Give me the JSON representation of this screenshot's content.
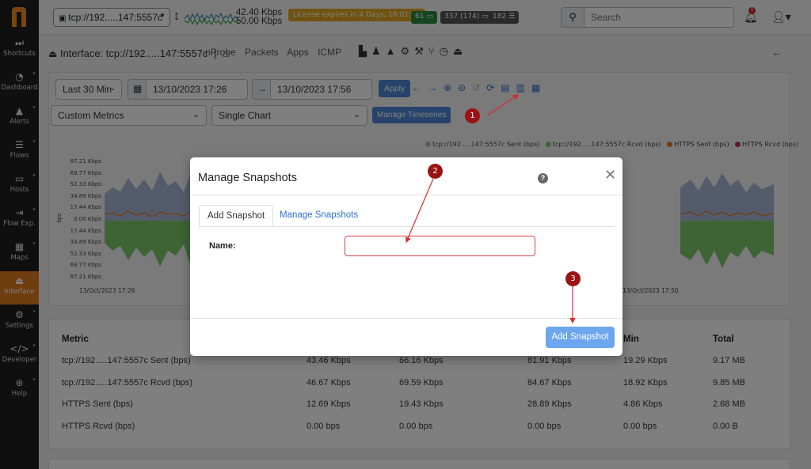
{
  "sidebar": {
    "items": [
      {
        "label": "Shortcuts",
        "icon": "fast-forward-icon"
      },
      {
        "label": "Dashboard",
        "icon": "gauge-icon"
      },
      {
        "label": "Alerts",
        "icon": "warning-icon"
      },
      {
        "label": "Flows",
        "icon": "list-icon"
      },
      {
        "label": "Hosts",
        "icon": "laptop-icon"
      },
      {
        "label": "Flow Exp.",
        "icon": "export-icon"
      },
      {
        "label": "Maps",
        "icon": "map-icon"
      },
      {
        "label": "Interface",
        "icon": "interface-icon",
        "active": true
      },
      {
        "label": "Settings",
        "icon": "gear-icon"
      },
      {
        "label": "Developer",
        "icon": "code-icon"
      },
      {
        "label": "Help",
        "icon": "life-ring-icon"
      }
    ]
  },
  "topbar": {
    "interface_label": "tcp://192.....147:5557c",
    "rate_up": "42.40 Kbps",
    "rate_down": "50.00 Kbps",
    "license": "License expires in 4 Days, 16:01:47",
    "badge_alerts": "61",
    "badge_hosts": "337 (174)",
    "badge_flows": "182",
    "search_placeholder": "Search",
    "notification_count": "1"
  },
  "page_header": {
    "title": "Interface: tcp://192.....147:5557c",
    "separator": "|",
    "links": [
      "nProbe",
      "Packets",
      "Apps",
      "ICMP"
    ]
  },
  "controls": {
    "range": "Last 30 Min",
    "date_from": "13/10/2023 17:26",
    "date_to": "13/10/2023 17:56",
    "apply": "Apply",
    "metrics": "Custom Metrics",
    "chart_mode": "Single Chart",
    "manage_timeseries": "Manage Timeseries"
  },
  "chart": {
    "legend": [
      {
        "name": "tcp://192.....147:5557c Sent (bps)",
        "color": "#a9b9d9"
      },
      {
        "name": "tcp://192.....147:5557c Rcvd (bps)",
        "color": "#7cc96a"
      },
      {
        "name": "HTTPS Sent (bps)",
        "color": "#e07a1f"
      },
      {
        "name": "HTTPS Rcvd (bps)",
        "color": "#b83a3a"
      }
    ],
    "yticks": [
      "87.21 Kbps",
      "69.77 Kbps",
      "52.33 Kbps",
      "34.89 Kbps",
      "17.44 Kbps",
      "0.00 Kbps",
      "17.44 Kbps",
      "34.89 Kbps",
      "52.33 Kbps",
      "69.77 Kbps",
      "87.21 Kbps"
    ],
    "ylabel": "bps",
    "xticks": [
      "13/Oct/2023 17:26",
      "13/Oct/2023 17:50"
    ]
  },
  "table": {
    "headers": [
      "Metric",
      "",
      "",
      "",
      "Min",
      "Total"
    ],
    "rows": [
      [
        "tcp://192.....147:5557c Sent (bps)",
        "43.46 Kbps",
        "66.16 Kbps",
        "81.91 Kbps",
        "19.29 Kbps",
        "9.17 MB"
      ],
      [
        "tcp://192.....147:5557c Rcvd (bps)",
        "46.67 Kbps",
        "69.59 Kbps",
        "84.67 Kbps",
        "18.92 Kbps",
        "9.85 MB"
      ],
      [
        "HTTPS Sent (bps)",
        "12.69 Kbps",
        "19.43 Kbps",
        "28.89 Kbps",
        "4.86 Kbps",
        "2.68 MB"
      ],
      [
        "HTTPS Rcvd (bps)",
        "0.00 bps",
        "0.00 bps",
        "0.00 bps",
        "0.00 bps",
        "0.00 B"
      ]
    ]
  },
  "modal": {
    "title": "Manage Snapshots",
    "tab_add": "Add Snapshot",
    "tab_manage": "Manage Snapshots",
    "name_label": "Name:",
    "name_value": "",
    "add_button": "Add Snapshot"
  },
  "markers": [
    "1",
    "2",
    "3"
  ]
}
